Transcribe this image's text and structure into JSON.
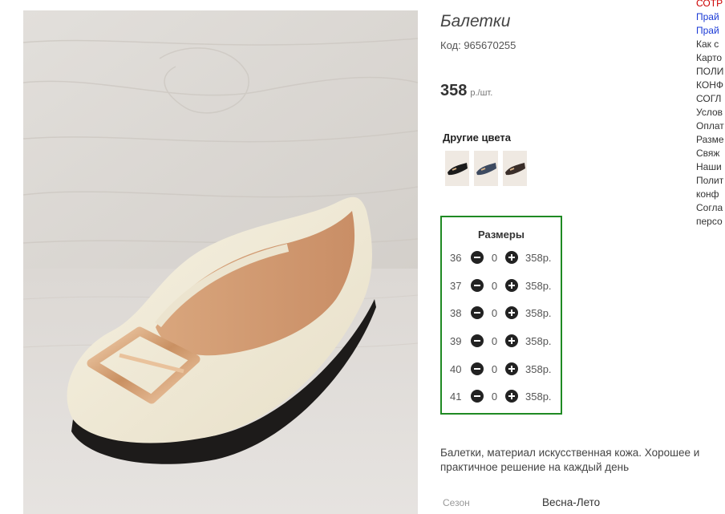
{
  "product": {
    "title": "Балетки",
    "code": "Код: 965670255",
    "price": "358",
    "price_unit": "р./шт."
  },
  "other_colors": {
    "title": "Другие цвета",
    "swatches": [
      "black",
      "blue-gray",
      "brown"
    ]
  },
  "sizes": {
    "title": "Размеры",
    "rows": [
      {
        "size": "36",
        "qty": "0",
        "price": "358р."
      },
      {
        "size": "37",
        "qty": "0",
        "price": "358р."
      },
      {
        "size": "38",
        "qty": "0",
        "price": "358р."
      },
      {
        "size": "39",
        "qty": "0",
        "price": "358р."
      },
      {
        "size": "40",
        "qty": "0",
        "price": "358р."
      },
      {
        "size": "41",
        "qty": "0",
        "price": "358р."
      }
    ]
  },
  "description": "Балетки, материал искусственная кожа. Хорошее и практичное решение на каждый день",
  "attributes": {
    "season_label": "Сезон",
    "season_value": "Весна-Лето"
  },
  "sidebar_links": [
    {
      "label": "СОТР",
      "style": "red"
    },
    {
      "label": "Прай",
      "style": "blue"
    },
    {
      "label": "Прай",
      "style": "blue"
    },
    {
      "label": "Как с",
      "style": "normal"
    },
    {
      "label": "Карто",
      "style": "normal"
    },
    {
      "label": "ПОЛИ",
      "style": "normal"
    },
    {
      "label": "КОНФ",
      "style": "normal"
    },
    {
      "label": "СОГЛ",
      "style": "normal"
    },
    {
      "label": "Услов",
      "style": "normal"
    },
    {
      "label": "Оплат",
      "style": "normal"
    },
    {
      "label": "Разме",
      "style": "normal"
    },
    {
      "label": "Свяж",
      "style": "normal"
    },
    {
      "label": "Наши",
      "style": "normal"
    },
    {
      "label": "Полит",
      "style": "normal"
    },
    {
      "label": "конф",
      "style": "normal"
    },
    {
      "label": "Согла",
      "style": "normal"
    },
    {
      "label": "персо",
      "style": "normal"
    }
  ],
  "colors": {
    "sizes_border": "#1f8a23",
    "link_blue": "#1a3ad6",
    "link_red": "#cc0000"
  }
}
